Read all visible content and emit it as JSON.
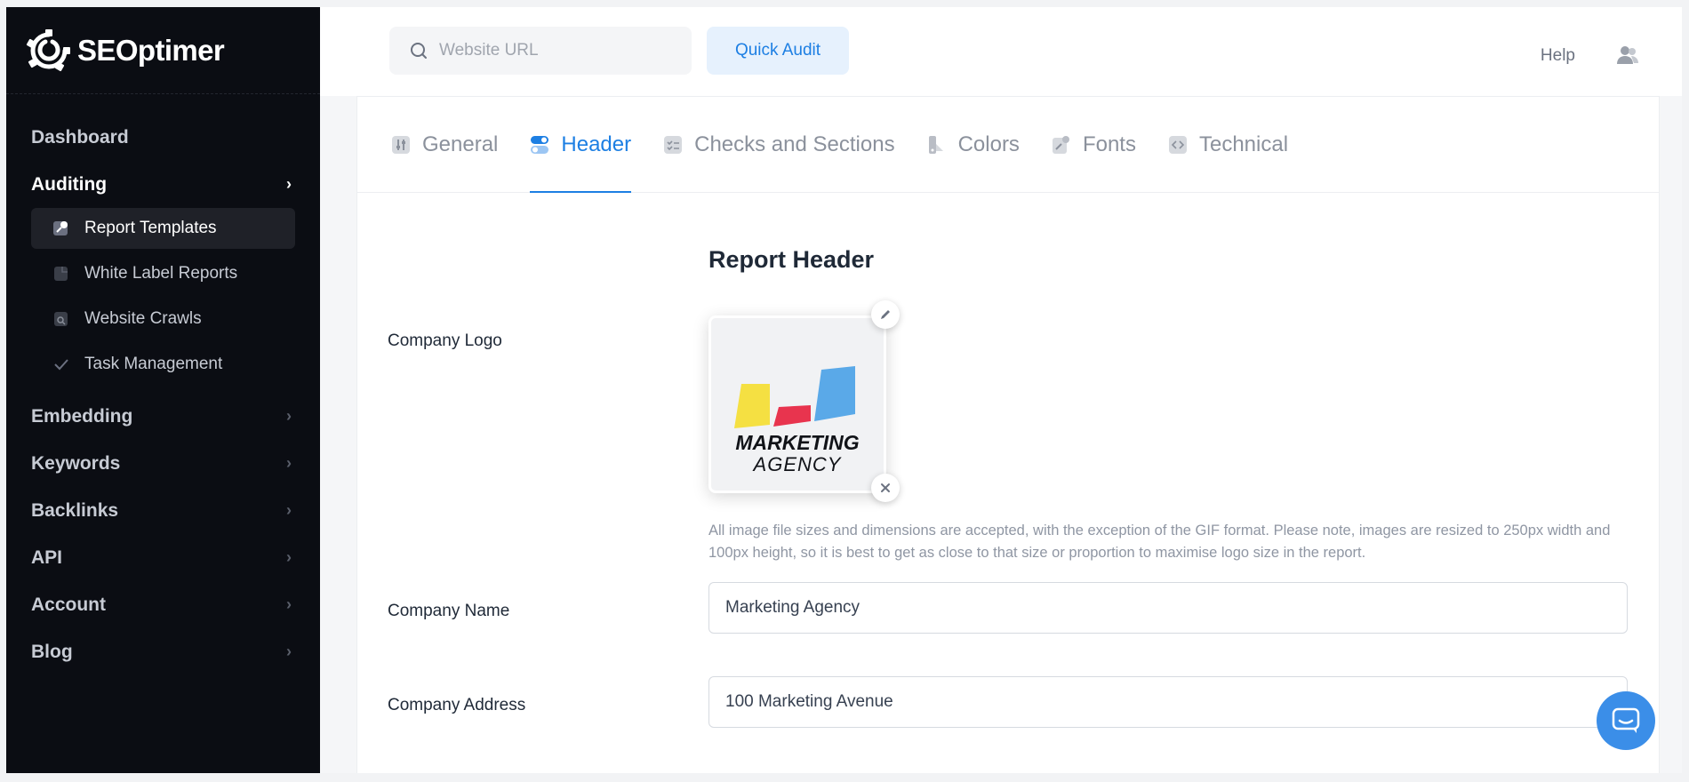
{
  "brand": {
    "name": "SEOptimer"
  },
  "sidebar": {
    "items": [
      {
        "label": "Dashboard"
      },
      {
        "label": "Auditing"
      },
      {
        "label": "Embedding"
      },
      {
        "label": "Keywords"
      },
      {
        "label": "Backlinks"
      },
      {
        "label": "API"
      },
      {
        "label": "Account"
      },
      {
        "label": "Blog"
      }
    ],
    "auditing_sub": [
      {
        "label": "Report Templates",
        "icon": "edit-doc-icon"
      },
      {
        "label": "White Label Reports",
        "icon": "document-icon"
      },
      {
        "label": "Website Crawls",
        "icon": "crawl-icon"
      },
      {
        "label": "Task Management",
        "icon": "check-icon"
      }
    ]
  },
  "topbar": {
    "search_placeholder": "Website URL",
    "quick_audit_label": "Quick Audit",
    "help_label": "Help"
  },
  "tabs": [
    {
      "label": "General",
      "icon": "sliders-icon"
    },
    {
      "label": "Header",
      "icon": "toggle-icon"
    },
    {
      "label": "Checks and Sections",
      "icon": "checklist-icon"
    },
    {
      "label": "Colors",
      "icon": "palette-icon"
    },
    {
      "label": "Fonts",
      "icon": "font-icon"
    },
    {
      "label": "Technical",
      "icon": "code-icon"
    }
  ],
  "form": {
    "section_title": "Report Header",
    "logo_label": "Company Logo",
    "logo_help": "All image file sizes and dimensions are accepted, with the exception of the GIF format. Please note, images are resized to 250px width and 100px height, so it is best to get as close to that size or proportion to maximise logo size in the report.",
    "logo_text_line1": "MARKETING",
    "logo_text_line2": "AGENCY",
    "company_name_label": "Company Name",
    "company_name_value": "Marketing Agency",
    "company_address_label": "Company Address",
    "company_address_value": "100 Marketing Avenue"
  },
  "colors": {
    "accent": "#1d7fe3",
    "sidebar_bg": "#0b0d13",
    "logo_yellow": "#f5e042",
    "logo_red": "#e8344e",
    "logo_blue": "#5aa9e8"
  }
}
